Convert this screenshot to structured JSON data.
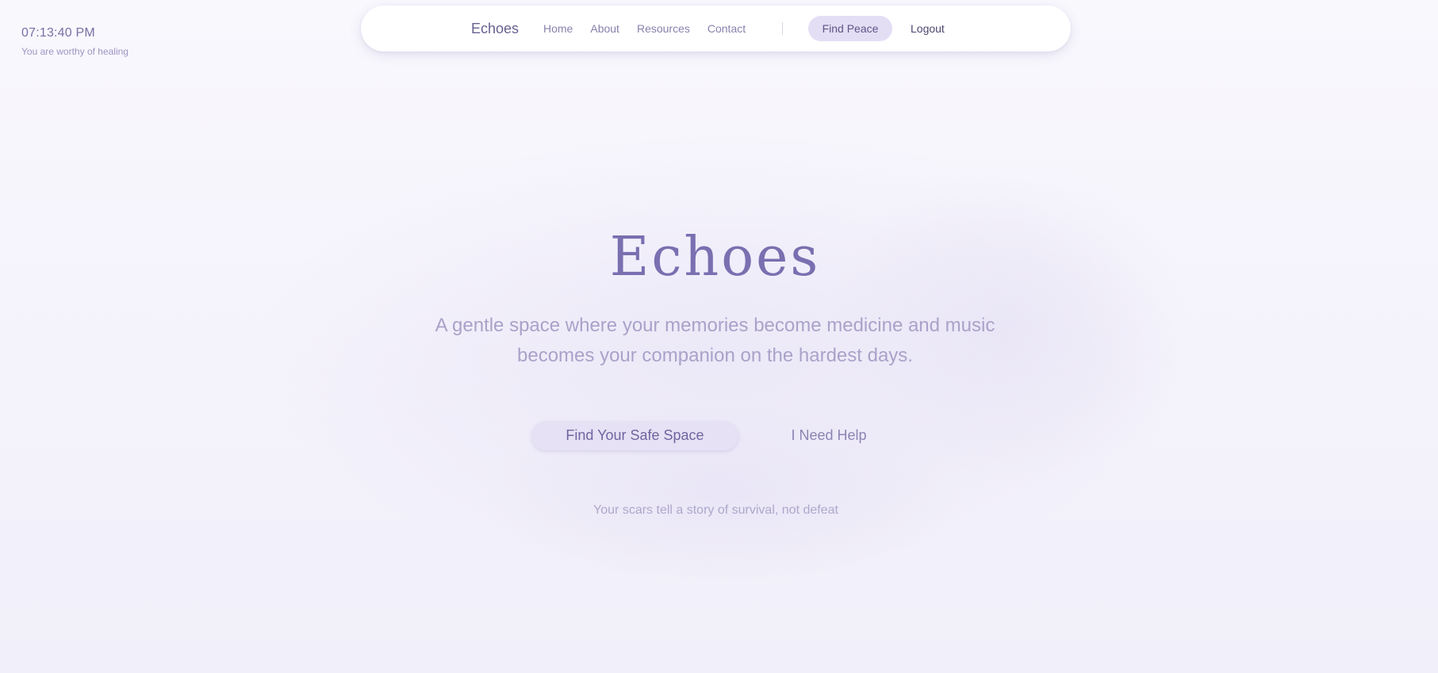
{
  "clock": {
    "time": "07:13:40 PM",
    "note": "You are worthy of healing"
  },
  "nav": {
    "brand": "Echoes",
    "links": [
      {
        "label": "Home"
      },
      {
        "label": "About"
      },
      {
        "label": "Resources"
      },
      {
        "label": "Contact"
      }
    ],
    "cta_label": "Find Peace",
    "logout_label": "Logout"
  },
  "hero": {
    "title": "Echoes",
    "subtitle": "A gentle space where your memories become medicine and music becomes your companion on the hardest days.",
    "primary_button": "Find Your Safe Space",
    "secondary_button": "I Need Help",
    "quote": "Your scars tell a story of survival, not defeat"
  },
  "colors": {
    "accent": "#7a6fb0",
    "pill": "#e4def5",
    "background": "#f6f4fc"
  }
}
